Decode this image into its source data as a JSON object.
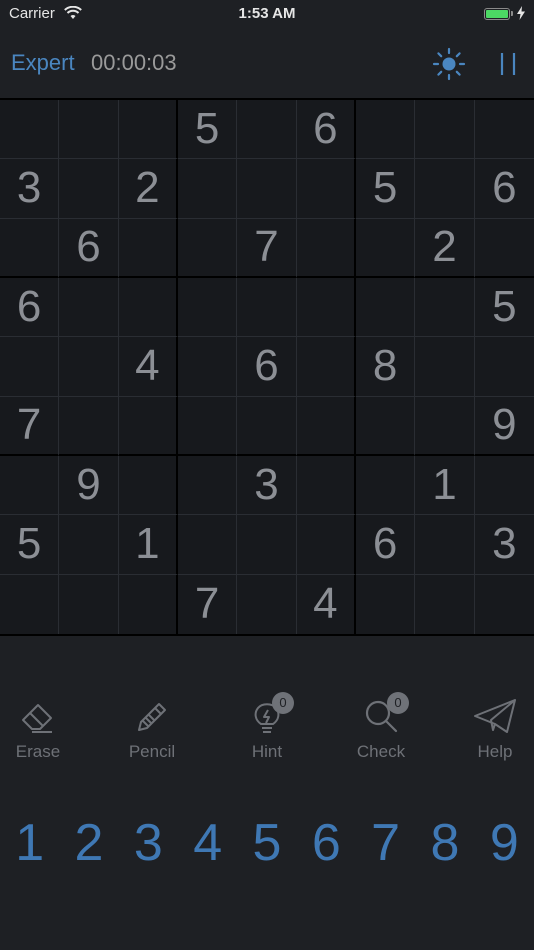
{
  "status_bar": {
    "carrier": "Carrier",
    "time": "1:53 AM"
  },
  "header": {
    "difficulty": "Expert",
    "timer": "00:00:03"
  },
  "board": [
    [
      "",
      "",
      "",
      "5",
      "",
      "6",
      "",
      "",
      ""
    ],
    [
      "3",
      "",
      "2",
      "",
      "",
      "",
      "5",
      "",
      "6"
    ],
    [
      "",
      "6",
      "",
      "",
      "7",
      "",
      "",
      "2",
      ""
    ],
    [
      "6",
      "",
      "",
      "",
      "",
      "",
      "",
      "",
      "5"
    ],
    [
      "",
      "",
      "4",
      "",
      "6",
      "",
      "8",
      "",
      ""
    ],
    [
      "7",
      "",
      "",
      "",
      "",
      "",
      "",
      "",
      "9"
    ],
    [
      "",
      "9",
      "",
      "",
      "3",
      "",
      "",
      "1",
      ""
    ],
    [
      "5",
      "",
      "1",
      "",
      "",
      "",
      "6",
      "",
      "3"
    ],
    [
      "",
      "",
      "",
      "7",
      "",
      "4",
      "",
      "",
      ""
    ]
  ],
  "tools": {
    "erase": {
      "label": "Erase",
      "icon": "eraser-icon"
    },
    "pencil": {
      "label": "Pencil",
      "icon": "pencil-icon"
    },
    "hint": {
      "label": "Hint",
      "count": "0",
      "icon": "lightbulb-icon"
    },
    "check": {
      "label": "Check",
      "count": "0",
      "icon": "magnifier-icon"
    },
    "help": {
      "label": "Help",
      "icon": "paper-plane-icon"
    }
  },
  "numpad": [
    "1",
    "2",
    "3",
    "4",
    "5",
    "6",
    "7",
    "8",
    "9"
  ],
  "colors": {
    "accent": "#4a86c0",
    "background": "#1e2024",
    "board": "#17191d",
    "given_digit": "#8c8f95",
    "battery": "#4cd964"
  }
}
